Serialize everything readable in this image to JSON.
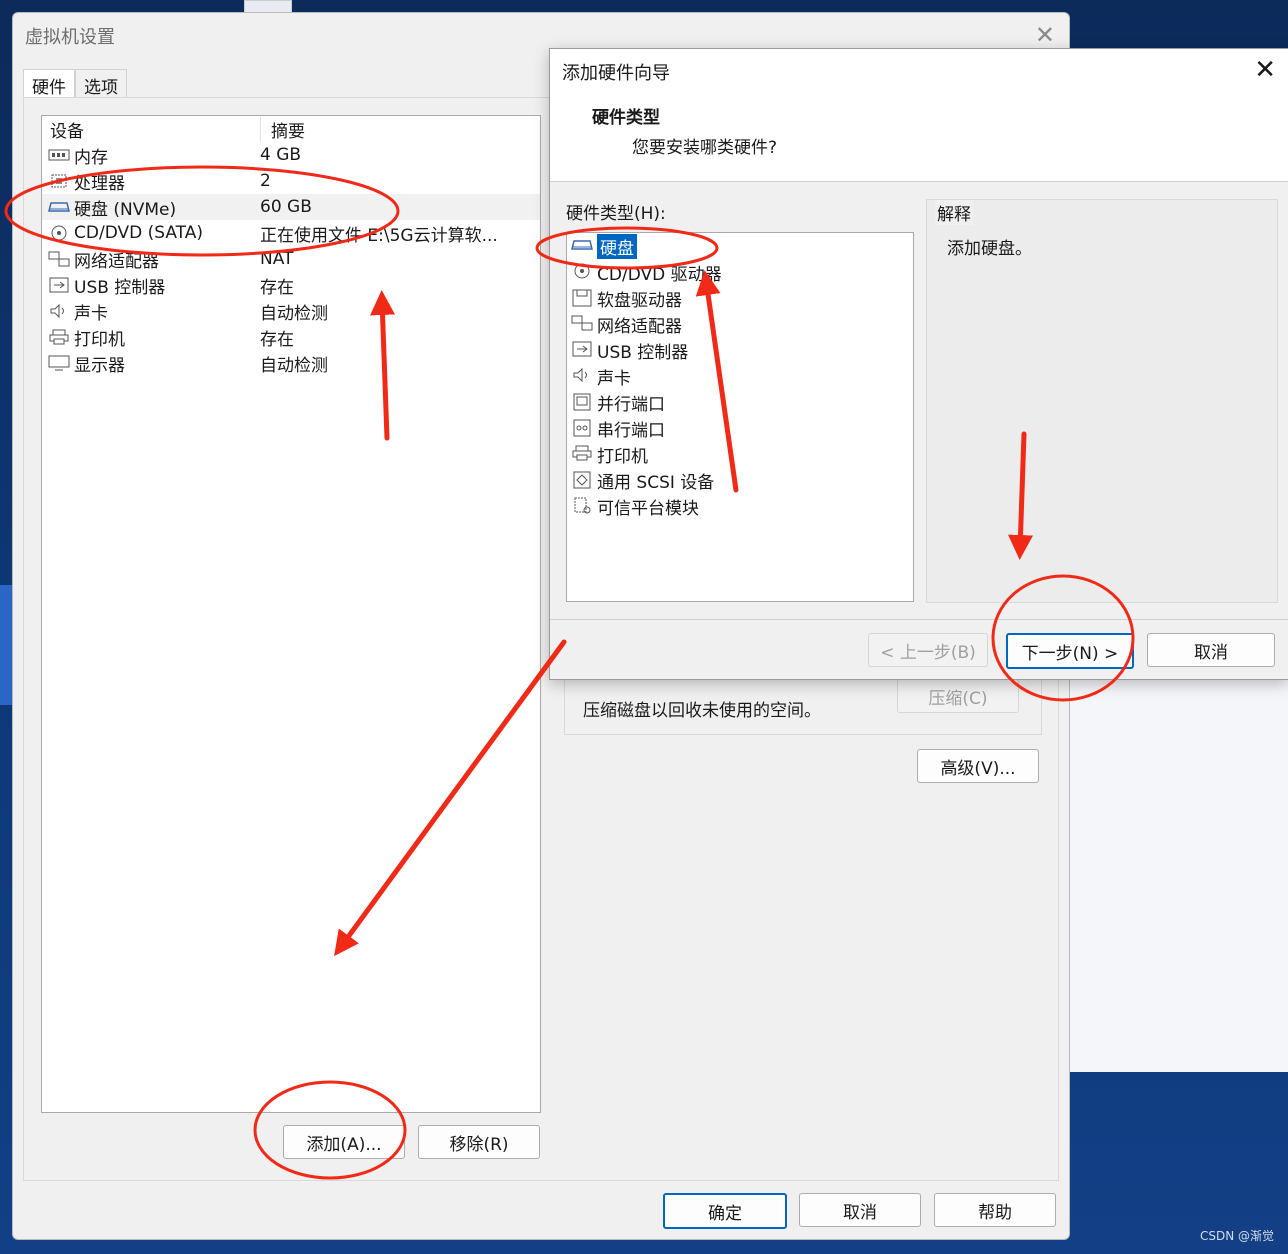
{
  "vm_window": {
    "title": "虚拟机设置",
    "close_label": "✕",
    "tabs": [
      {
        "label": "硬件",
        "active": true
      },
      {
        "label": "选项",
        "active": false
      }
    ],
    "device_list": {
      "columns": [
        "设备",
        "摘要"
      ],
      "rows": [
        {
          "name": "内存",
          "summary": "4 GB",
          "icon": "memory-icon"
        },
        {
          "name": "处理器",
          "summary": "2",
          "icon": "cpu-icon"
        },
        {
          "name": "硬盘 (NVMe)",
          "summary": "60 GB",
          "icon": "harddisk-icon",
          "selected": true
        },
        {
          "name": "CD/DVD (SATA)",
          "summary": "正在使用文件 E:\\5G云计算软...",
          "icon": "cd-icon"
        },
        {
          "name": "网络适配器",
          "summary": "NAT",
          "icon": "network-icon"
        },
        {
          "name": "USB 控制器",
          "summary": "存在",
          "icon": "usb-icon"
        },
        {
          "name": "声卡",
          "summary": "自动检测",
          "icon": "speaker-icon"
        },
        {
          "name": "打印机",
          "summary": "存在",
          "icon": "printer-icon"
        },
        {
          "name": "显示器",
          "summary": "自动检测",
          "icon": "monitor-icon"
        }
      ]
    },
    "add_button": "添加(A)...",
    "remove_button": "移除(R)",
    "compress_text": "压缩磁盘以回收未使用的空间。",
    "compress_button": "压缩(C)",
    "advanced_button": "高级(V)...",
    "ok_button": "确定",
    "cancel_button": "取消",
    "help_button": "帮助"
  },
  "wizard": {
    "title": "添加硬件向导",
    "close_label": "✕",
    "header_title": "硬件类型",
    "header_subtitle": "您要安装哪类硬件?",
    "hardware_type_label": "硬件类型(H):",
    "hardware_types": [
      {
        "label": "硬盘",
        "icon": "harddisk-icon",
        "selected": true
      },
      {
        "label": "CD/DVD 驱动器",
        "icon": "cd-icon"
      },
      {
        "label": "软盘驱动器",
        "icon": "floppy-icon"
      },
      {
        "label": "网络适配器",
        "icon": "network-icon"
      },
      {
        "label": "USB 控制器",
        "icon": "usb-icon"
      },
      {
        "label": "声卡",
        "icon": "speaker-icon"
      },
      {
        "label": "并行端口",
        "icon": "parallel-port-icon"
      },
      {
        "label": "串行端口",
        "icon": "serial-port-icon"
      },
      {
        "label": "打印机",
        "icon": "printer-icon"
      },
      {
        "label": "通用 SCSI 设备",
        "icon": "scsi-icon"
      },
      {
        "label": "可信平台模块",
        "icon": "tpm-icon"
      }
    ],
    "explain_label": "解释",
    "explain_text": "添加硬盘。",
    "back_button": "< 上一步(B)",
    "next_button": "下一步(N) >",
    "cancel_button": "取消"
  },
  "watermark": "CSDN @渐觉",
  "colors": {
    "selection_blue": "#0067c0",
    "annotation_red": "#f02a17",
    "desktop_blue": "#0e3a7a"
  }
}
